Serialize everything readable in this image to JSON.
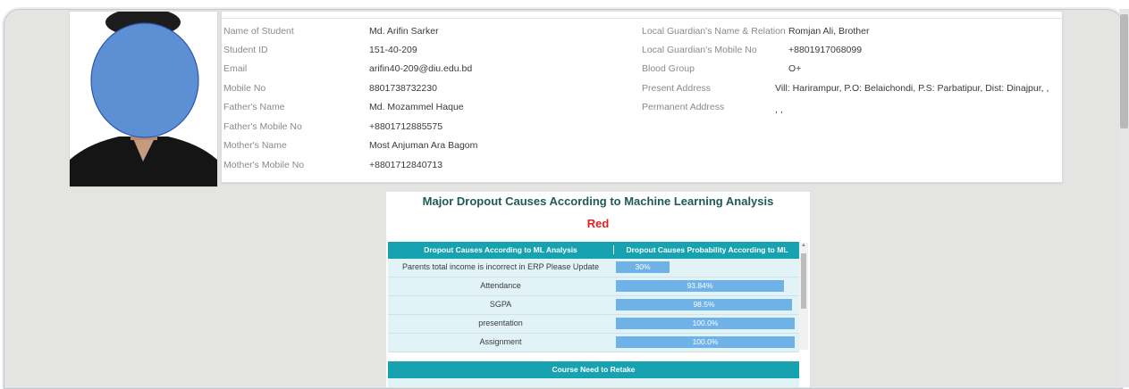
{
  "student": {
    "left_fields": [
      {
        "label": "Name of Student",
        "value": "Md. Arifin Sarker"
      },
      {
        "label": "Student ID",
        "value": "151-40-209"
      },
      {
        "label": "Email",
        "value": "arifin40-209@diu.edu.bd"
      },
      {
        "label": "Mobile No",
        "value": "8801738732230"
      },
      {
        "label": "Father's Name",
        "value": "Md. Mozammel Haque"
      },
      {
        "label": "Father's Mobile No",
        "value": "+8801712885575"
      },
      {
        "label": "Mother's Name",
        "value": "Most Anjuman Ara Bagom"
      },
      {
        "label": "Mother's Mobile No",
        "value": "+8801712840713"
      }
    ],
    "right_fields": [
      {
        "label": "Local Guardian's Name & Relation",
        "value": "Romjan Ali, Brother"
      },
      {
        "label": "Local Guardian's Mobile No",
        "value": "+8801917068099"
      },
      {
        "label": "Blood Group",
        "value": "O+"
      },
      {
        "label": "Present Address",
        "value": "Vill: Harirampur, P.O: Belaichondi, P.S: Parbatipur, Dist: Dinajpur, ,"
      },
      {
        "label": "Permanent Address",
        "value": ", ,"
      }
    ]
  },
  "ml_analysis": {
    "title": "Major Dropout Causes According to Machine Learning Analysis",
    "status": "Red",
    "status_color": "#e02020",
    "header_color": "#16a2b0",
    "bar_color": "#6fb2e8",
    "columns": [
      "Dropout Causes According to ML Analysis",
      "Dropout Causes Probability According to ML"
    ],
    "rows": [
      {
        "cause": "Parents total income is incorrect in ERP Please Update",
        "label": "30%",
        "fraction": 0.3
      },
      {
        "cause": "Attendance",
        "label": "93.84%",
        "fraction": 0.9384
      },
      {
        "cause": "SGPA",
        "label": "98.5%",
        "fraction": 0.985
      },
      {
        "cause": "presentation",
        "label": "100.0%",
        "fraction": 1.0
      },
      {
        "cause": "Assignment",
        "label": "100.0%",
        "fraction": 1.0
      }
    ],
    "retake_header": "Course Need to Retake"
  }
}
